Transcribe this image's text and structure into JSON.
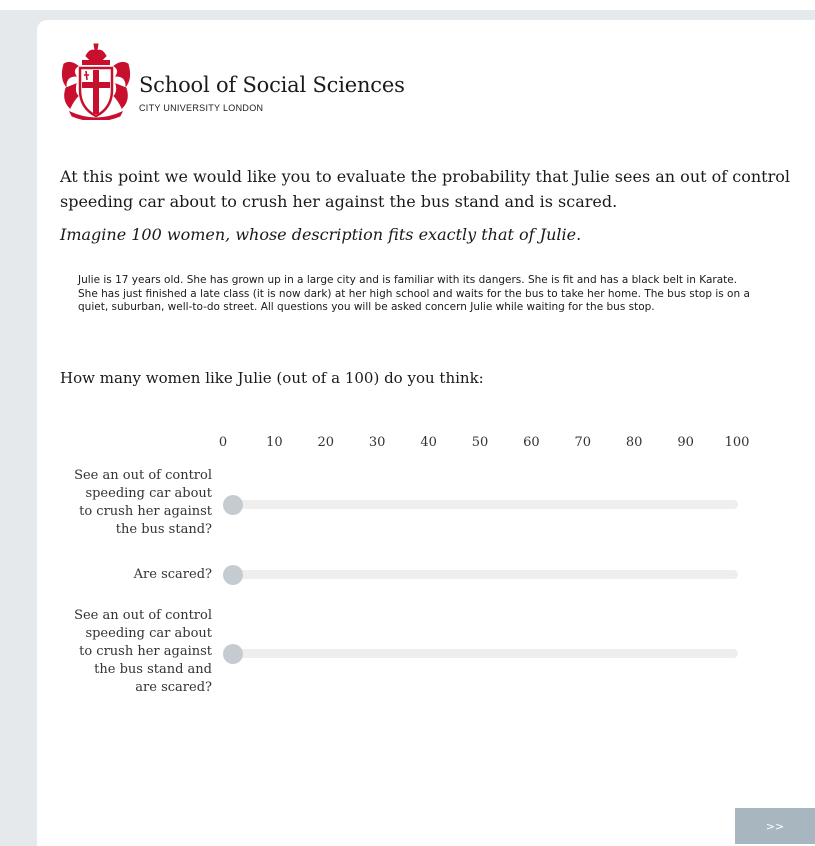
{
  "header": {
    "school_name": "School of Social Sciences",
    "university_name": "CITY UNIVERSITY LONDON",
    "logo_icon": "city-university-crest-icon",
    "logo_color": "#c8102e"
  },
  "question": {
    "text": "At this point we would like you to evaluate the probability that Julie sees an out of control speeding car about to crush her against the bus stand and is scared.",
    "instruction": "Imagine 100 women, whose description fits exactly that of Julie.",
    "description": "Julie is 17 years old. She has grown up in a large city and is familiar with its dangers. She is fit and has a black belt in Karate. She has just finished a late class (it is now dark) at her high school and waits for the bus to take her home.  The bus stop is on a quiet, suburban, well-to-do street. All questions you will be asked concern Julie while waiting for the bus stop.",
    "prompt": "How many women like Julie (out of a 100) do you think:"
  },
  "scale": {
    "labels": [
      "0",
      "10",
      "20",
      "30",
      "40",
      "50",
      "60",
      "70",
      "80",
      "90",
      "100"
    ],
    "min": 0,
    "max": 100
  },
  "sliders": [
    {
      "label_lines": [
        "See an out of control",
        "speeding car about",
        "to crush her against",
        "the bus stand?"
      ],
      "value": 0
    },
    {
      "label_lines": [
        "Are scared?"
      ],
      "value": 0
    },
    {
      "label_lines": [
        "See an out of control",
        "speeding car about",
        "to crush her against",
        "the bus stand and",
        "are scared?"
      ],
      "value": 0
    }
  ],
  "navigation": {
    "next_label": ">>"
  },
  "colors": {
    "track": "#eeeeee",
    "handle": "#c5ccd1",
    "next_button": "#a8b6bf"
  }
}
